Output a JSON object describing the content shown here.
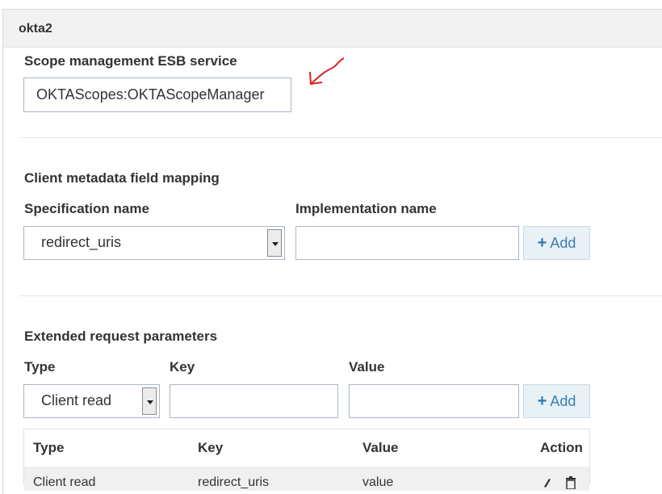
{
  "panel": {
    "title": "okta2"
  },
  "scope": {
    "label": "Scope management ESB service",
    "value": "OKTAScopes:OKTAScopeManager"
  },
  "client_metadata": {
    "heading": "Client metadata field mapping",
    "spec_label": "Specification name",
    "impl_label": "Implementation name",
    "spec_selected": "redirect_uris",
    "impl_value": "",
    "add_label": "Add"
  },
  "extended": {
    "heading": "Extended request parameters",
    "type_label": "Type",
    "key_label": "Key",
    "value_label": "Value",
    "type_selected": "Client read",
    "key_value": "",
    "value_value": "",
    "add_label": "Add",
    "table": {
      "headers": [
        "Type",
        "Key",
        "Value",
        "Action"
      ],
      "rows": [
        {
          "type": "Client read",
          "key": "redirect_uris",
          "value": "value"
        }
      ]
    }
  },
  "colors": {
    "annotation_arrow": "#e02020",
    "add_button_text": "#3a7fb0"
  }
}
